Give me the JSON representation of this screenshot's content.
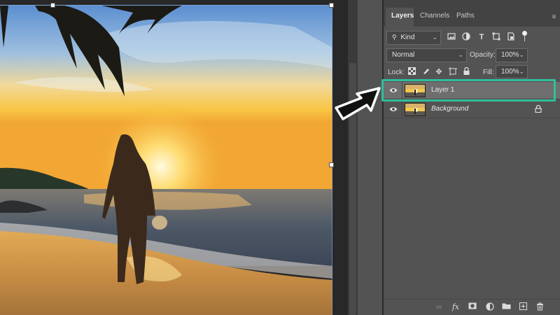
{
  "panel": {
    "tabs": [
      {
        "label": "Layers",
        "active": true
      },
      {
        "label": "Channels",
        "active": false
      },
      {
        "label": "Paths",
        "active": false
      }
    ],
    "menu_icon": "hamburger-menu-icon"
  },
  "filter": {
    "kind_label": "Kind",
    "icons": [
      "search-icon",
      "pixel-filter-icon",
      "adjustment-filter-icon",
      "type-filter-icon",
      "shape-filter-icon",
      "smart-object-filter-icon"
    ]
  },
  "blend": {
    "mode": "Normal",
    "opacity_label": "Opacity:",
    "opacity_value": "100%"
  },
  "lock": {
    "label": "Lock:",
    "icons": [
      "lock-transparent-icon",
      "lock-image-icon",
      "lock-position-icon",
      "lock-artboard-icon",
      "lock-all-icon"
    ],
    "fill_label": "Fill:",
    "fill_value": "100%"
  },
  "layers": [
    {
      "name": "Layer 1",
      "selected": true,
      "visible": true
    },
    {
      "name": "Background",
      "selected": false,
      "visible": true,
      "locked": true
    }
  ],
  "bottom_bar": {
    "icons": [
      "link-layers-icon",
      "fx-icon",
      "add-mask-icon",
      "adjustment-layer-icon",
      "new-group-icon",
      "new-layer-icon",
      "delete-icon"
    ],
    "fx_label": "fx"
  },
  "colors": {
    "highlight": "#2fbf9b",
    "panel_bg": "#535353",
    "selected_row": "#6e6e6e"
  }
}
